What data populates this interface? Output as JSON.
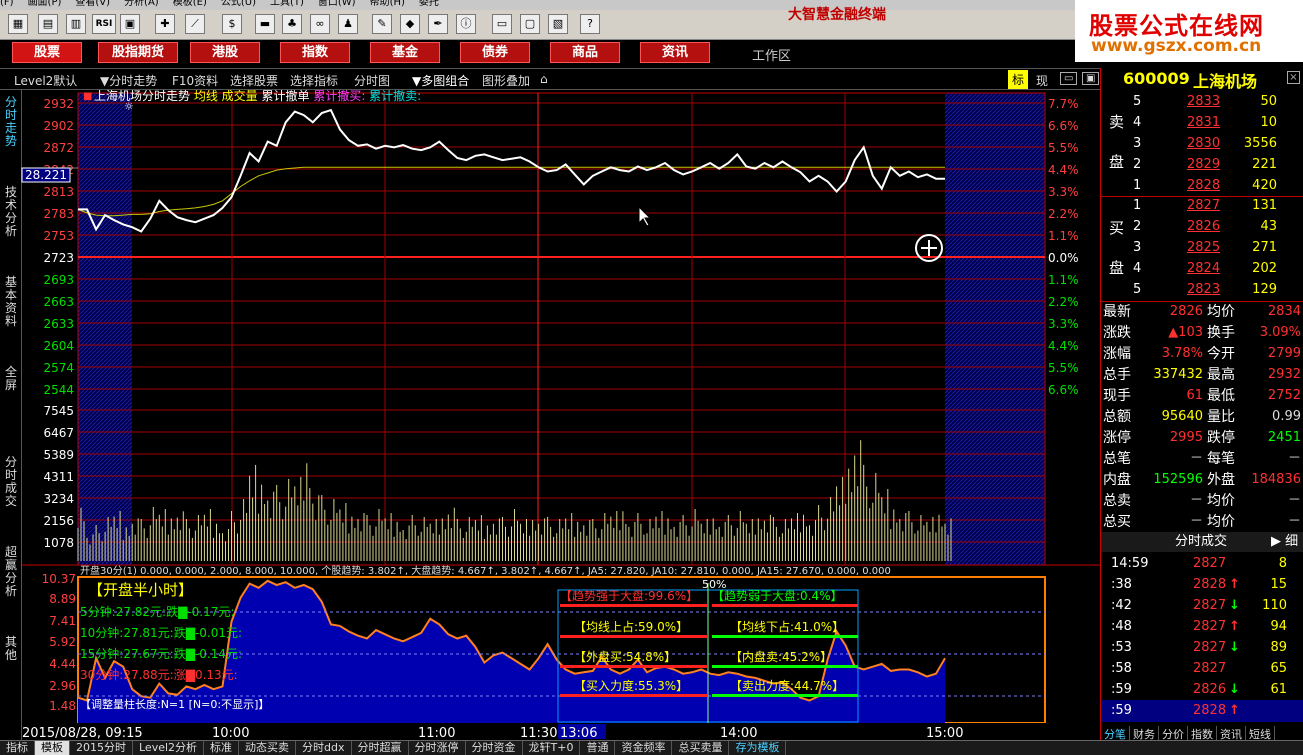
{
  "menu": [
    "(F)",
    "画面(P)",
    "查看(V)",
    "分析(A)",
    "模板(E)",
    "公式(U)",
    "工具(T)",
    "窗口(W)",
    "帮助(H)",
    "委托"
  ],
  "app_title": "大智慧金融终端",
  "logo": {
    "line1": "股票公式在线网",
    "line2": "www.gszx.com.cn"
  },
  "nav": [
    "股票",
    "股指期货",
    "港股",
    "指数",
    "基金",
    "债券",
    "商品",
    "资讯"
  ],
  "workspace": "工作区",
  "options": [
    "Level2默认",
    "分时走势",
    "F10资料",
    "选择股票",
    "选择指标",
    "分时图",
    "多图组合",
    "图形叠加"
  ],
  "opt_right": {
    "biao": "标",
    "xian": "现"
  },
  "left_tabs": [
    "分时走势",
    "技术分析",
    "基本资料",
    "全屏",
    "分时成交",
    "超赢分析",
    "其他"
  ],
  "chart_data": {
    "type": "line",
    "title": "上海机场分时走势",
    "legend": [
      "均线",
      "成交量",
      "累计撤单",
      "累计撤买:",
      "累计撤卖:"
    ],
    "price_ticks": [
      "2932",
      "2902",
      "2872",
      "2842",
      "2813",
      "2783",
      "2753",
      "2723",
      "2693",
      "2663",
      "2633",
      "2604",
      "2574",
      "2544"
    ],
    "pct_ticks": [
      "7.7%",
      "6.6%",
      "5.5%",
      "4.4%",
      "3.3%",
      "2.2%",
      "1.1%",
      "0.0%",
      "1.1%",
      "2.2%",
      "3.3%",
      "4.4%",
      "5.5%",
      "6.6%"
    ],
    "cursor_price": "28.221",
    "vol_ticks": [
      "7545",
      "6467",
      "5389",
      "4311",
      "3234",
      "2156",
      "1078"
    ],
    "price": [
      2783,
      2783,
      2755,
      2775,
      2768,
      2762,
      2758,
      2752,
      2770,
      2795,
      2782,
      2772,
      2768,
      2765,
      2770,
      2775,
      2785,
      2800,
      2830,
      2862,
      2850,
      2878,
      2872,
      2905,
      2920,
      2915,
      2905,
      2918,
      2922,
      2895,
      2880,
      2872,
      2874,
      2868,
      2872,
      2870,
      2873,
      2868,
      2866,
      2870,
      2878,
      2866,
      2855,
      2852,
      2858,
      2860,
      2856,
      2852,
      2854,
      2856,
      2850,
      2842,
      2836,
      2838,
      2846,
      2832,
      2818,
      2830,
      2836,
      2842,
      2838,
      2836,
      2843,
      2838,
      2842,
      2848,
      2838,
      2832,
      2836,
      2842,
      2848,
      2840,
      2848,
      2860,
      2843,
      2840,
      2848,
      2842,
      2850,
      2842,
      2835,
      2822,
      2830,
      2822,
      2808,
      2822,
      2852,
      2870,
      2830,
      2812,
      2842,
      2830,
      2836,
      2828,
      2832,
      2826,
      2826
    ],
    "avg": [
      2783,
      2778,
      2775,
      2774,
      2774,
      2775,
      2776,
      2776,
      2777,
      2780,
      2782,
      2783,
      2784,
      2785,
      2787,
      2790,
      2795,
      2805,
      2815,
      2823,
      2830,
      2834,
      2838,
      2840,
      2841,
      2842,
      2842,
      2842,
      2842,
      2842,
      2842,
      2842,
      2842,
      2842,
      2842,
      2842,
      2842,
      2842,
      2842,
      2842,
      2842,
      2842,
      2842,
      2842,
      2842,
      2842,
      2842,
      2842,
      2842,
      2842,
      2842,
      2842,
      2842,
      2842,
      2842,
      2842,
      2842,
      2842,
      2842,
      2842,
      2842,
      2842,
      2842,
      2842,
      2842,
      2842,
      2842,
      2842,
      2842,
      2842,
      2842,
      2842,
      2842,
      2842,
      2842,
      2842,
      2842,
      2842,
      2842,
      2842,
      2842,
      2842,
      2842,
      2842,
      2842,
      2842,
      2842,
      2842,
      2842,
      2842,
      2842,
      2842,
      2842,
      2842,
      2842,
      2842,
      2842
    ],
    "volume": [
      3000,
      1500,
      1800,
      2200,
      2500,
      1900,
      2400,
      2100,
      2700,
      2600,
      2400,
      2800,
      2100,
      2300,
      2600,
      2100,
      1800,
      2500,
      3100,
      4800,
      4300,
      3900,
      3800,
      4100,
      4200,
      5500,
      3700,
      3300,
      3100,
      2900,
      2500,
      2700,
      2300,
      2600,
      2400,
      2200,
      2000,
      2300,
      2200,
      2100,
      2400,
      3000,
      2100,
      2200,
      2300,
      2000,
      2400,
      2200,
      2600,
      2100,
      2300,
      2400,
      2200,
      2100,
      2400,
      2200,
      2300,
      2100,
      2400,
      2500,
      2800,
      2200,
      2400,
      2100,
      2500,
      2400,
      2200,
      2300,
      2600,
      2100,
      2400,
      2200,
      2300,
      2500,
      2100,
      2400,
      2600,
      2200,
      2100,
      2400,
      2600,
      2300,
      2800,
      3200,
      4200,
      5200,
      6800,
      4800,
      4400,
      3600,
      2900,
      2700,
      2500,
      2300,
      2200,
      2600,
      2400
    ],
    "time_ticks": [
      "2015/08/28, 09:15",
      "10:00",
      "11:00",
      "11:30",
      "13:06",
      "14:00",
      "15:00"
    ]
  },
  "vol_legend": "开盘30分(1) 0.000, 0.000, 2.000, 8.000, 10.000, 个股趋势: 3.802↑, 大盘趋势: 4.667↑, 3.802↑, 4.667↑, JA5: 27.820, JA10: 27.810, 0.000, JA15: 27.670, 0.000, 0.000",
  "ind": {
    "y_ticks": [
      "10.37",
      "8.89",
      "7.41",
      "5.92",
      "4.44",
      "2.96",
      "1.48"
    ],
    "title": "【开盘半小时】",
    "rows": [
      "5分钟:27.82元:跌▇-0.17元:",
      "10分钟:27.81元:跌▇-0.01元:",
      "15分钟:27.67元:跌▇-0.14元:",
      "30分钟:27.88元:涨▇0.13元:"
    ],
    "note": "【调整量柱长度:N=1 [N=0:不显示]】",
    "strong": "【趋势强于大盘:99.6%】",
    "weak": "【趋势弱于大盘:0.4%】",
    "ma_up": "【均线上占:59.0%】",
    "ma_down": "【均线下占:41.0%】",
    "out": "【外盘买:54.8%】",
    "in": "【内盘卖:45.2%】",
    "buy": "【买入力度:55.3%】",
    "sell": "【卖出力度:44.7%】",
    "fifty": "50%",
    "series": [
      1.8,
      1.6,
      4.6,
      3.2,
      4.4,
      4.0,
      2.4,
      1.9,
      1.8,
      2.8,
      2.1,
      2.0,
      2.6,
      2.4,
      2.7,
      2.4,
      2.6,
      7.2,
      8.9,
      9.9,
      9.6,
      10.1,
      9.8,
      10.0,
      9.6,
      9.8,
      9.5,
      8.6,
      7.0,
      6.9,
      6.5,
      6.2,
      6.0,
      6.6,
      6.3,
      6.0,
      5.8,
      6.1,
      6.4,
      7.4,
      7.0,
      6.3,
      6.0,
      6.2,
      5.4,
      4.3,
      4.8,
      5.0,
      4.6,
      4.2,
      3.8,
      4.6,
      5.6,
      4.5,
      3.8,
      3.5,
      3.6,
      3.7,
      4.7,
      3.8,
      3.5,
      3.8,
      4.5,
      3.6,
      3.9,
      4.0,
      3.8,
      3.5,
      3.6,
      3.8,
      3.5,
      3.4,
      3.6,
      3.5,
      3.3,
      3.2,
      3.0,
      2.8,
      2.9,
      2.4,
      1.8,
      1.6,
      1.9,
      4.5,
      6.5,
      5.5,
      4.0,
      3.8,
      4.0,
      4.2,
      3.7,
      3.8,
      3.8,
      3.6,
      3.3,
      3.5,
      4.6
    ]
  },
  "stock": {
    "code": "600009",
    "name": "上海机场"
  },
  "sell_orders": [
    {
      "n": "5",
      "p": "2833",
      "v": "50"
    },
    {
      "n": "4",
      "p": "2831",
      "v": "10"
    },
    {
      "n": "3",
      "p": "2830",
      "v": "3556"
    },
    {
      "n": "2",
      "p": "2829",
      "v": "221"
    },
    {
      "n": "1",
      "p": "2828",
      "v": "420"
    }
  ],
  "buy_orders": [
    {
      "n": "1",
      "p": "2827",
      "v": "131"
    },
    {
      "n": "2",
      "p": "2826",
      "v": "43"
    },
    {
      "n": "3",
      "p": "2825",
      "v": "271"
    },
    {
      "n": "4",
      "p": "2824",
      "v": "202"
    },
    {
      "n": "5",
      "p": "2823",
      "v": "129"
    }
  ],
  "side_labels": {
    "sell1": "卖",
    "sell2": "盘",
    "buy1": "买",
    "buy2": "盘"
  },
  "quote": [
    {
      "l": "最新",
      "v": "2826",
      "l2": "均价",
      "v2": "2834"
    },
    {
      "l": "涨跌",
      "v": "▲103",
      "l2": "换手",
      "v2": "3.09%"
    },
    {
      "l": "涨幅",
      "v": "3.78%",
      "l2": "今开",
      "v2": "2799"
    },
    {
      "l": "总手",
      "v": "337432",
      "l2": "最高",
      "v2": "2932"
    },
    {
      "l": "现手",
      "v": "61",
      "l2": "最低",
      "v2": "2752"
    },
    {
      "l": "总额",
      "v": "95640",
      "l2": "量比",
      "v2": "0.99"
    },
    {
      "l": "涨停",
      "v": "2995",
      "l2": "跌停",
      "v2": "2451"
    },
    {
      "l": "总笔",
      "v": "－",
      "l2": "每笔",
      "v2": "－"
    },
    {
      "l": "内盘",
      "v": "152596",
      "l2": "外盘",
      "v2": "184836"
    },
    {
      "l": "总卖",
      "v": "－",
      "l2": "均价",
      "v2": "－"
    },
    {
      "l": "总买",
      "v": "－",
      "l2": "均价",
      "v2": "－"
    }
  ],
  "ticks_header": "分时成交",
  "ticks_detail": "细",
  "ticks": [
    {
      "t": "14:59",
      "p": "2827",
      "a": "",
      "v": "8"
    },
    {
      "t": ":38",
      "p": "2828",
      "a": "↑",
      "v": "15"
    },
    {
      "t": ":42",
      "p": "2827",
      "a": "↓",
      "v": "110"
    },
    {
      "t": ":48",
      "p": "2827",
      "a": "↑",
      "v": "94"
    },
    {
      "t": ":53",
      "p": "2827",
      "a": "↓",
      "v": "89"
    },
    {
      "t": ":58",
      "p": "2827",
      "a": "",
      "v": "65"
    },
    {
      "t": ":59",
      "p": "2826",
      "a": "↓",
      "v": "61"
    },
    {
      "t": ":59",
      "p": "2828",
      "a": "↑",
      "v": ""
    }
  ],
  "bottom_tabs": [
    "指标",
    "模板",
    "2015分时",
    "Level2分析",
    "标准",
    "动态买卖",
    "分时ddx",
    "分时超赢",
    "分时涨停",
    "分时资金",
    "龙轩T+0",
    "普通",
    "资金频率",
    "总买卖量",
    "存为模板"
  ],
  "right_bottom_tabs": [
    "分笔",
    "财务",
    "分价",
    "指数",
    "资讯",
    "短线"
  ],
  "colors": {
    "up": "#ff3030",
    "down": "#00e000",
    "yellow": "#ffff00",
    "cyan": "#00ffff",
    "grid": "#a00000"
  }
}
